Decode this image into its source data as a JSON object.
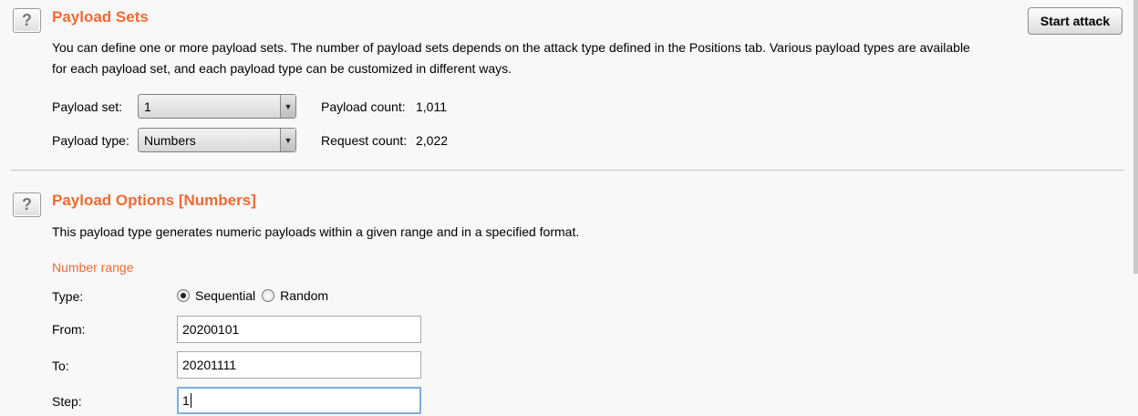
{
  "payload_sets": {
    "title": "Payload Sets",
    "help_icon": "?",
    "description_line1": "You can define one or more payload sets. The number of payload sets depends on the attack type defined in the Positions tab. Various payload types are available",
    "description_line2": "for each payload set, and each payload type can be customized in different ways.",
    "payload_set_label": "Payload set:",
    "payload_set_value": "1",
    "payload_type_label": "Payload type:",
    "payload_type_value": "Numbers",
    "payload_count_label": "Payload count:",
    "payload_count_value": "1,011",
    "request_count_label": "Request count:",
    "request_count_value": "2,022"
  },
  "toolbar": {
    "start_attack_label": "Start attack"
  },
  "payload_options": {
    "title": "Payload Options [Numbers]",
    "help_icon": "?",
    "description": "This payload type generates numeric payloads within a given range and in a specified format.",
    "number_range_heading": "Number range",
    "type_label": "Type:",
    "type_options": [
      "Sequential",
      "Random"
    ],
    "type_selected": "Sequential",
    "from_label": "From:",
    "from_value": "20200101",
    "to_label": "To:",
    "to_value": "20201111",
    "step_label": "Step:",
    "step_value": "1"
  },
  "colors": {
    "section_title": "#f06a35",
    "focus_border": "#7eaee0"
  },
  "icons": {
    "help": "help-icon",
    "dropdown": "chevron-down-icon"
  }
}
